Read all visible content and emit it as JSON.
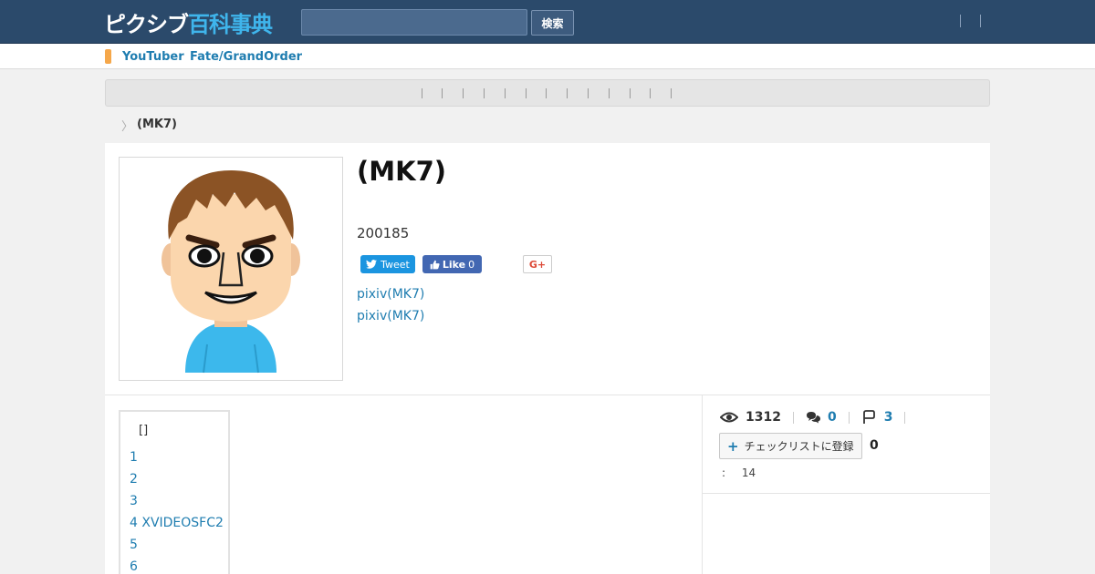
{
  "header": {
    "logo_part1": "ピクシブ",
    "logo_part2": "百科事典",
    "search_placeholder": "",
    "search_button": "検索"
  },
  "subnav": {
    "links": [
      "YouTuber",
      "Fate/GrandOrder"
    ]
  },
  "breadcrumb": {
    "current": "(MK7)"
  },
  "article": {
    "title": "(MK7)",
    "count": "200185",
    "share": {
      "tweet_label": "Tweet",
      "like_label": "Like",
      "like_count": "0",
      "gplus_label": "G+"
    },
    "links": [
      "pixiv(MK7)",
      "pixiv(MK7)"
    ]
  },
  "toc": {
    "title": "[]",
    "items": [
      "1",
      "2",
      "3",
      "4 XVIDEOSFC2",
      "5",
      "6"
    ]
  },
  "stats": {
    "views": "1312",
    "comments": "0",
    "pins": "3",
    "checklist_label": "チェックリストに登録",
    "checklist_count": "0",
    "extra_label": ":",
    "extra_value": "14"
  },
  "colors": {
    "header_bg": "#2b4a6b",
    "logo_accent": "#3fb5ec",
    "link": "#1f7db0",
    "tweet": "#1b95e0",
    "facebook": "#4267b2",
    "tag_marker": "#f5a74a"
  }
}
